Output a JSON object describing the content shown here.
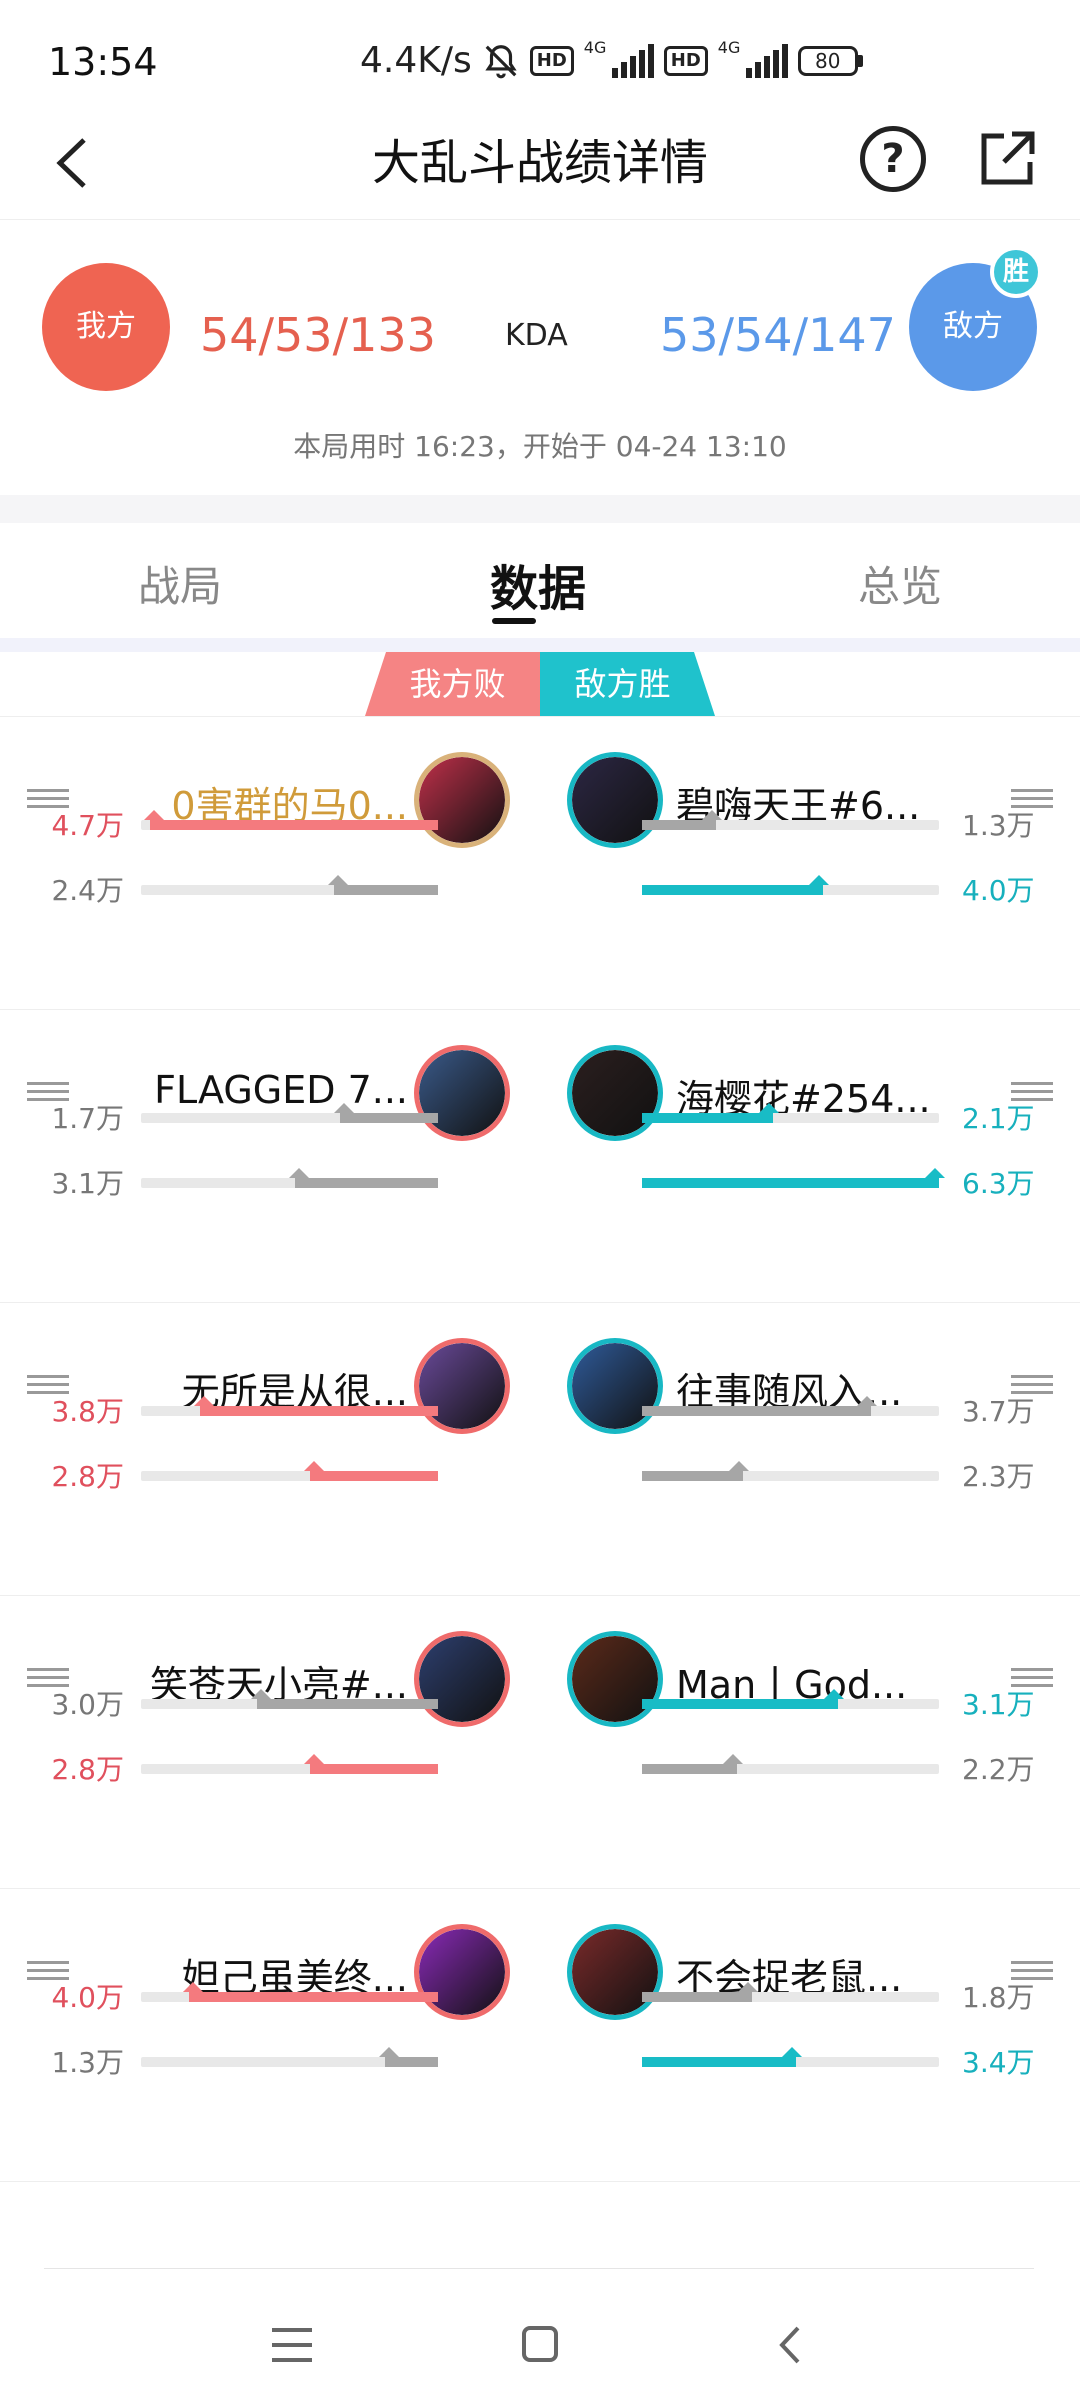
{
  "status_bar": {
    "time": "13:54",
    "speed": "4.4K/s",
    "battery": "80",
    "network_1": "4G",
    "network_2": "4G",
    "hd_1": "HD",
    "hd_2": "HD"
  },
  "nav": {
    "title": "大乱斗战绩详情",
    "help_glyph": "?"
  },
  "summary": {
    "my_team_label": "我方",
    "enemy_team_label": "敌方",
    "win_badge": "胜",
    "my_kda": "54/53/133",
    "kda_label": "KDA",
    "enemy_kda": "53/54/147",
    "time_info": "本局用时 16:23，开始于 04-24 13:10"
  },
  "tabs": [
    {
      "label": "战局"
    },
    {
      "label": "数据"
    },
    {
      "label": "总览"
    }
  ],
  "active_tab": "数据",
  "result_banner": {
    "my_result": "我方败",
    "enemy_result": "敌方胜"
  },
  "colors": {
    "my_team": "#ef6452",
    "enemy_team": "#5b99e9",
    "win_accent": "#1fc2cc",
    "lose_accent": "#f58484"
  },
  "players": [
    {
      "left": {
        "name": "0害群的马0...",
        "stat1": "4.7万",
        "stat1_fill": 0.97,
        "stat1_color": "red",
        "stat2": "2.4万",
        "stat2_fill": 0.35,
        "stat2_color": "grey",
        "name_color": "gold"
      },
      "right": {
        "name": "碧嗨天王#6...",
        "stat1": "1.3万",
        "stat1_fill": 0.25,
        "stat1_color": "grey",
        "stat2": "4.0万",
        "stat2_fill": 0.61,
        "stat2_color": "cyan"
      }
    },
    {
      "left": {
        "name": "FLAGGED 7...",
        "stat1": "1.7万",
        "stat1_fill": 0.33,
        "stat1_color": "grey",
        "stat2": "3.1万",
        "stat2_fill": 0.48,
        "stat2_color": "grey"
      },
      "right": {
        "name": "海樱花#254...",
        "stat1": "2.1万",
        "stat1_fill": 0.44,
        "stat1_color": "cyan",
        "stat2": "6.3万",
        "stat2_fill": 1.0,
        "stat2_color": "cyan"
      }
    },
    {
      "left": {
        "name": "无所是从很...",
        "stat1": "3.8万",
        "stat1_fill": 0.8,
        "stat1_color": "red",
        "stat2": "2.8万",
        "stat2_fill": 0.43,
        "stat2_color": "red"
      },
      "right": {
        "name": "往事随风入...",
        "stat1": "3.7万",
        "stat1_fill": 0.77,
        "stat1_color": "grey",
        "stat2": "2.3万",
        "stat2_fill": 0.34,
        "stat2_color": "grey"
      }
    },
    {
      "left": {
        "name": "笑苍天小亮#...",
        "stat1": "3.0万",
        "stat1_fill": 0.61,
        "stat1_color": "grey",
        "stat2": "2.8万",
        "stat2_fill": 0.43,
        "stat2_color": "red"
      },
      "right": {
        "name": "Man丨God...",
        "stat1": "3.1万",
        "stat1_fill": 0.66,
        "stat1_color": "cyan",
        "stat2": "2.2万",
        "stat2_fill": 0.32,
        "stat2_color": "grey"
      }
    },
    {
      "left": {
        "name": "妲己虽美终...",
        "stat1": "4.0万",
        "stat1_fill": 0.84,
        "stat1_color": "red",
        "stat2": "1.3万",
        "stat2_fill": 0.18,
        "stat2_color": "grey"
      },
      "right": {
        "name": "不会捉老鼠...",
        "stat1": "1.8万",
        "stat1_fill": 0.37,
        "stat1_color": "grey",
        "stat2": "3.4万",
        "stat2_fill": 0.52,
        "stat2_color": "cyan"
      }
    }
  ]
}
